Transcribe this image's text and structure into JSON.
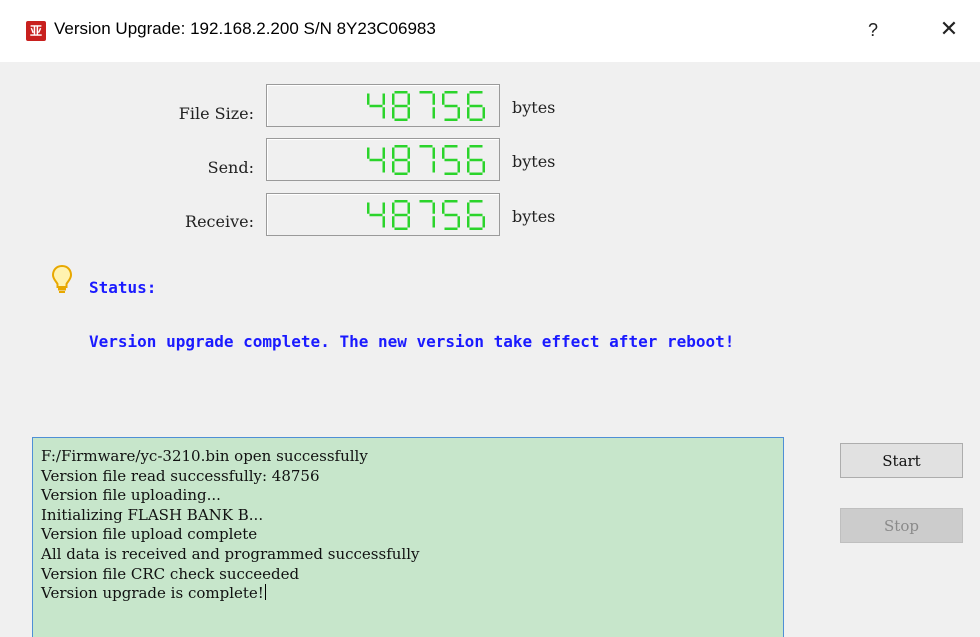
{
  "window": {
    "icon_text": "亚",
    "title": "Version Upgrade: 192.168.2.200  S/N 8Y23C06983",
    "help_label": "?",
    "close_label": "✕"
  },
  "fields": [
    {
      "label": "File Size:",
      "value": "48756",
      "unit": "bytes"
    },
    {
      "label": "Send:",
      "value": "48756",
      "unit": "bytes"
    },
    {
      "label": "Receive:",
      "value": "48756",
      "unit": "bytes"
    }
  ],
  "status": {
    "icon": "lightbulb-icon",
    "label": "Status:",
    "message": "Version upgrade complete. The new version take effect after reboot!"
  },
  "log": {
    "lines": [
      "F:/Firmware/yc-3210.bin open successfully",
      "Version file read successfully: 48756",
      "Version file uploading...",
      "Initializing FLASH BANK B...",
      "Version file upload complete",
      "All data is received and programmed successfully",
      "Version file CRC check succeeded",
      "Version upgrade is complete!"
    ]
  },
  "buttons": {
    "start_label": "Start",
    "stop_label": "Stop"
  },
  "colors": {
    "lcd_digit": "#2bd42b",
    "status_text": "#1a1aff",
    "log_background": "#c7e6cb",
    "app_icon": "#c8201e"
  }
}
